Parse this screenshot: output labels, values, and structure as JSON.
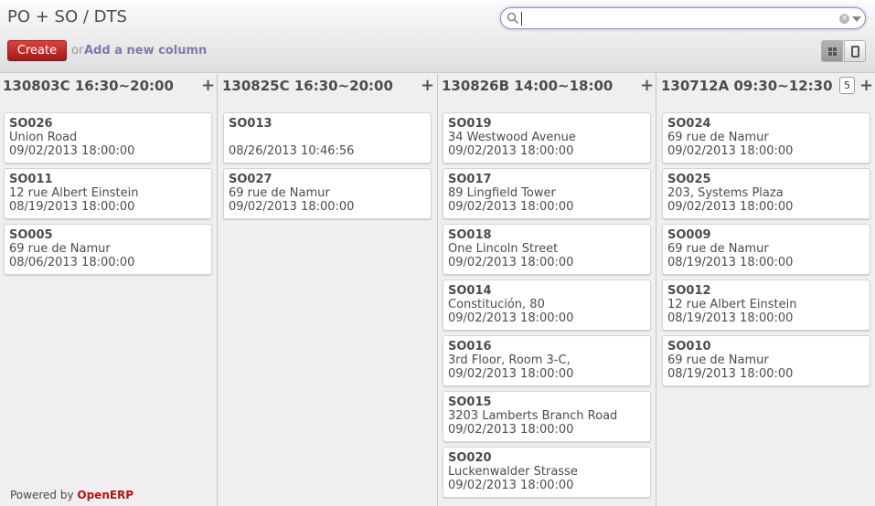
{
  "header": {
    "title": "PO + SO / DTS",
    "search_value": "",
    "create_label": "Create",
    "or_label": "or",
    "add_column_label": "Add a new column"
  },
  "footer": {
    "powered_by": "Powered by",
    "brand": "OpenERP"
  },
  "columns": [
    {
      "title": "130803C 16:30~20:00",
      "plus": "+",
      "count": "",
      "cards": [
        {
          "ref": "SO026",
          "addr": "Union Road",
          "date": "09/02/2013 18:00:00"
        },
        {
          "ref": "SO011",
          "addr": "12 rue Albert Einstein",
          "date": "08/19/2013 18:00:00"
        },
        {
          "ref": "SO005",
          "addr": "69 rue de Namur",
          "date": "08/06/2013 18:00:00"
        }
      ]
    },
    {
      "title": "130825C 16:30~20:00",
      "plus": "+",
      "count": "",
      "cards": [
        {
          "ref": "SO013",
          "addr": "",
          "date": "08/26/2013 10:46:56"
        },
        {
          "ref": "SO027",
          "addr": "69 rue de Namur",
          "date": "09/02/2013 18:00:00"
        }
      ]
    },
    {
      "title": "130826B 14:00~18:00",
      "plus": "+",
      "count": "",
      "cards": [
        {
          "ref": "SO019",
          "addr": "34 Westwood Avenue",
          "date": "09/02/2013 18:00:00"
        },
        {
          "ref": "SO017",
          "addr": "89 Lingfield Tower",
          "date": "09/02/2013 18:00:00"
        },
        {
          "ref": "SO018",
          "addr": "One Lincoln Street",
          "date": "09/02/2013 18:00:00"
        },
        {
          "ref": "SO014",
          "addr": "Constitución, 80",
          "date": "09/02/2013 18:00:00"
        },
        {
          "ref": "SO016",
          "addr": "3rd Floor, Room 3-C,",
          "date": "09/02/2013 18:00:00"
        },
        {
          "ref": "SO015",
          "addr": "3203 Lamberts Branch Road",
          "date": "09/02/2013 18:00:00"
        },
        {
          "ref": "SO020",
          "addr": "Luckenwalder Strasse",
          "date": "09/02/2013 18:00:00"
        }
      ]
    },
    {
      "title": "130712A 09:30~12:30",
      "plus": "+",
      "count": "5",
      "cards": [
        {
          "ref": "SO024",
          "addr": "69 rue de Namur",
          "date": "09/02/2013 18:00:00"
        },
        {
          "ref": "SO025",
          "addr": "203, Systems Plaza",
          "date": "09/02/2013 18:00:00"
        },
        {
          "ref": "SO009",
          "addr": "69 rue de Namur",
          "date": "08/19/2013 18:00:00"
        },
        {
          "ref": "SO012",
          "addr": "12 rue Albert Einstein",
          "date": "08/19/2013 18:00:00"
        },
        {
          "ref": "SO010",
          "addr": "69 rue de Namur",
          "date": "08/19/2013 18:00:00"
        }
      ]
    }
  ],
  "icons": {
    "search": "search-icon",
    "clear": "clear-icon",
    "dropdown": "dropdown-icon",
    "kanban": "kanban-view-icon",
    "form": "form-view-icon"
  }
}
